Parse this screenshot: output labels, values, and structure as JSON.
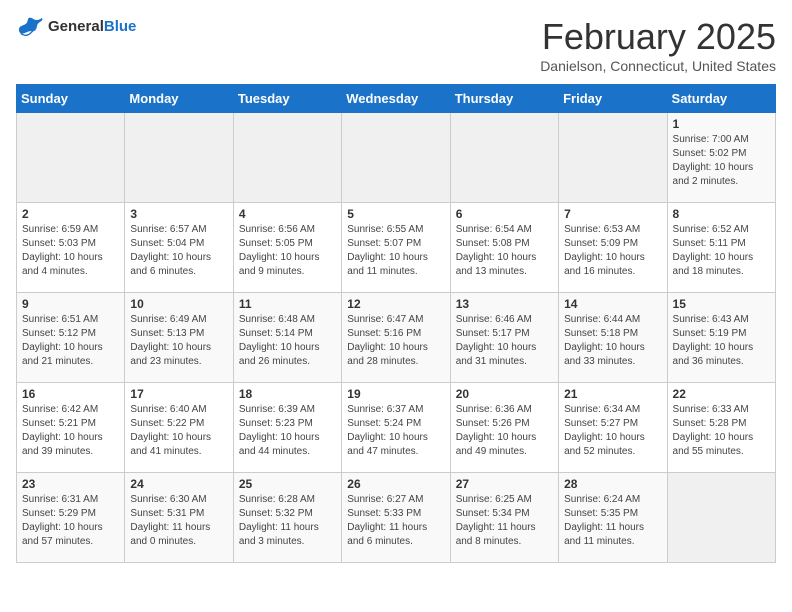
{
  "header": {
    "logo_general": "General",
    "logo_blue": "Blue",
    "month_title": "February 2025",
    "location": "Danielson, Connecticut, United States"
  },
  "days_of_week": [
    "Sunday",
    "Monday",
    "Tuesday",
    "Wednesday",
    "Thursday",
    "Friday",
    "Saturday"
  ],
  "weeks": [
    [
      {
        "day": "",
        "info": ""
      },
      {
        "day": "",
        "info": ""
      },
      {
        "day": "",
        "info": ""
      },
      {
        "day": "",
        "info": ""
      },
      {
        "day": "",
        "info": ""
      },
      {
        "day": "",
        "info": ""
      },
      {
        "day": "1",
        "info": "Sunrise: 7:00 AM\nSunset: 5:02 PM\nDaylight: 10 hours and 2 minutes."
      }
    ],
    [
      {
        "day": "2",
        "info": "Sunrise: 6:59 AM\nSunset: 5:03 PM\nDaylight: 10 hours and 4 minutes."
      },
      {
        "day": "3",
        "info": "Sunrise: 6:57 AM\nSunset: 5:04 PM\nDaylight: 10 hours and 6 minutes."
      },
      {
        "day": "4",
        "info": "Sunrise: 6:56 AM\nSunset: 5:05 PM\nDaylight: 10 hours and 9 minutes."
      },
      {
        "day": "5",
        "info": "Sunrise: 6:55 AM\nSunset: 5:07 PM\nDaylight: 10 hours and 11 minutes."
      },
      {
        "day": "6",
        "info": "Sunrise: 6:54 AM\nSunset: 5:08 PM\nDaylight: 10 hours and 13 minutes."
      },
      {
        "day": "7",
        "info": "Sunrise: 6:53 AM\nSunset: 5:09 PM\nDaylight: 10 hours and 16 minutes."
      },
      {
        "day": "8",
        "info": "Sunrise: 6:52 AM\nSunset: 5:11 PM\nDaylight: 10 hours and 18 minutes."
      }
    ],
    [
      {
        "day": "9",
        "info": "Sunrise: 6:51 AM\nSunset: 5:12 PM\nDaylight: 10 hours and 21 minutes."
      },
      {
        "day": "10",
        "info": "Sunrise: 6:49 AM\nSunset: 5:13 PM\nDaylight: 10 hours and 23 minutes."
      },
      {
        "day": "11",
        "info": "Sunrise: 6:48 AM\nSunset: 5:14 PM\nDaylight: 10 hours and 26 minutes."
      },
      {
        "day": "12",
        "info": "Sunrise: 6:47 AM\nSunset: 5:16 PM\nDaylight: 10 hours and 28 minutes."
      },
      {
        "day": "13",
        "info": "Sunrise: 6:46 AM\nSunset: 5:17 PM\nDaylight: 10 hours and 31 minutes."
      },
      {
        "day": "14",
        "info": "Sunrise: 6:44 AM\nSunset: 5:18 PM\nDaylight: 10 hours and 33 minutes."
      },
      {
        "day": "15",
        "info": "Sunrise: 6:43 AM\nSunset: 5:19 PM\nDaylight: 10 hours and 36 minutes."
      }
    ],
    [
      {
        "day": "16",
        "info": "Sunrise: 6:42 AM\nSunset: 5:21 PM\nDaylight: 10 hours and 39 minutes."
      },
      {
        "day": "17",
        "info": "Sunrise: 6:40 AM\nSunset: 5:22 PM\nDaylight: 10 hours and 41 minutes."
      },
      {
        "day": "18",
        "info": "Sunrise: 6:39 AM\nSunset: 5:23 PM\nDaylight: 10 hours and 44 minutes."
      },
      {
        "day": "19",
        "info": "Sunrise: 6:37 AM\nSunset: 5:24 PM\nDaylight: 10 hours and 47 minutes."
      },
      {
        "day": "20",
        "info": "Sunrise: 6:36 AM\nSunset: 5:26 PM\nDaylight: 10 hours and 49 minutes."
      },
      {
        "day": "21",
        "info": "Sunrise: 6:34 AM\nSunset: 5:27 PM\nDaylight: 10 hours and 52 minutes."
      },
      {
        "day": "22",
        "info": "Sunrise: 6:33 AM\nSunset: 5:28 PM\nDaylight: 10 hours and 55 minutes."
      }
    ],
    [
      {
        "day": "23",
        "info": "Sunrise: 6:31 AM\nSunset: 5:29 PM\nDaylight: 10 hours and 57 minutes."
      },
      {
        "day": "24",
        "info": "Sunrise: 6:30 AM\nSunset: 5:31 PM\nDaylight: 11 hours and 0 minutes."
      },
      {
        "day": "25",
        "info": "Sunrise: 6:28 AM\nSunset: 5:32 PM\nDaylight: 11 hours and 3 minutes."
      },
      {
        "day": "26",
        "info": "Sunrise: 6:27 AM\nSunset: 5:33 PM\nDaylight: 11 hours and 6 minutes."
      },
      {
        "day": "27",
        "info": "Sunrise: 6:25 AM\nSunset: 5:34 PM\nDaylight: 11 hours and 8 minutes."
      },
      {
        "day": "28",
        "info": "Sunrise: 6:24 AM\nSunset: 5:35 PM\nDaylight: 11 hours and 11 minutes."
      },
      {
        "day": "",
        "info": ""
      }
    ]
  ]
}
